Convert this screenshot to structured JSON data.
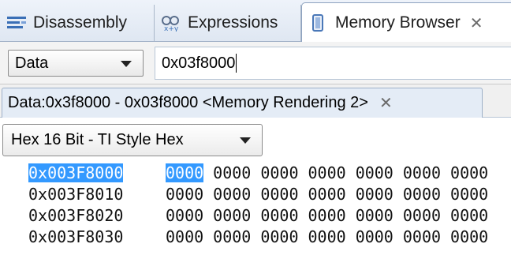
{
  "tabs": [
    {
      "label": "Disassembly",
      "icon": "disassembly-icon"
    },
    {
      "label": "Expressions",
      "icon": "expressions-icon"
    },
    {
      "label": "Memory Browser",
      "icon": "memory-browser-icon",
      "active": true
    }
  ],
  "address_bar": {
    "memory_space": "Data",
    "address_value": "0x03f8000"
  },
  "rendering_tab": {
    "label": "Data:0x3f8000 - 0x03f8000 <Memory Rendering 2>"
  },
  "format": {
    "selected": "Hex 16 Bit - TI Style Hex"
  },
  "memory_rows": [
    {
      "address": "0x003F8000",
      "values": [
        "0000",
        "0000",
        "0000",
        "0000",
        "0000",
        "0000",
        "0000"
      ]
    },
    {
      "address": "0x003F8010",
      "values": [
        "0000",
        "0000",
        "0000",
        "0000",
        "0000",
        "0000",
        "0000"
      ]
    },
    {
      "address": "0x003F8020",
      "values": [
        "0000",
        "0000",
        "0000",
        "0000",
        "0000",
        "0000",
        "0000"
      ]
    },
    {
      "address": "0x003F8030",
      "values": [
        "0000",
        "0000",
        "0000",
        "0000",
        "0000",
        "0000",
        "0000"
      ]
    }
  ],
  "colors": {
    "selection": "#3399ff",
    "tab_strip": "#dfe7f2"
  }
}
